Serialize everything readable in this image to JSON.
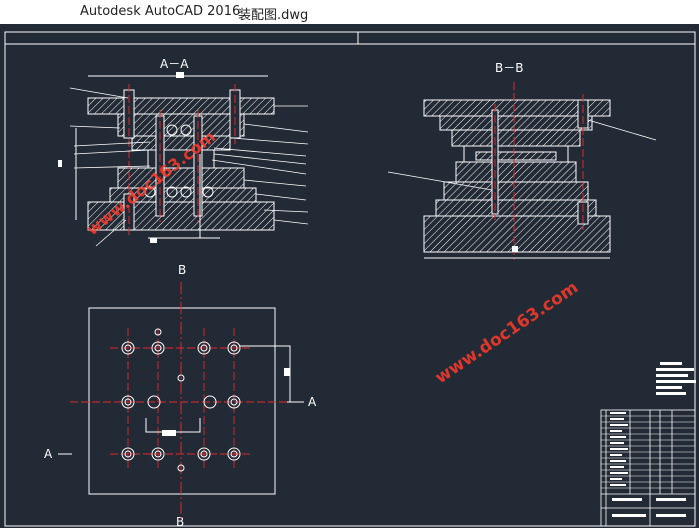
{
  "window": {
    "app_title": "Autodesk AutoCAD 2016",
    "file_name": "装配图.dwg"
  },
  "drawing": {
    "section_aa_label": "A－A",
    "section_bb_label": "B－B",
    "plan_label_b_top": "B",
    "plan_label_b_bottom": "B",
    "plan_label_a_left": "A",
    "plan_label_a_right": "A",
    "watermark": "www.doc163.com"
  },
  "colors": {
    "background": "#222a35",
    "lines": "#ffffff",
    "center_lines": "#e0262a",
    "hatch": "#ffffff"
  }
}
